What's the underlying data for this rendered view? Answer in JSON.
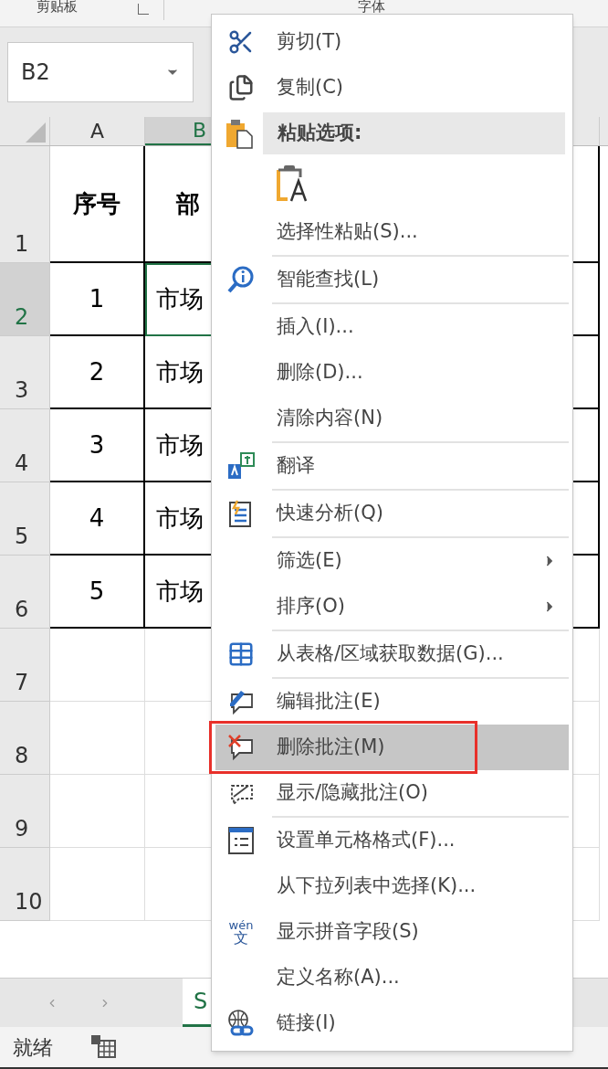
{
  "ribbon": {
    "groups": [
      {
        "label": "剪贴板"
      },
      {
        "label": "字体"
      }
    ]
  },
  "name_box": {
    "value": "B2"
  },
  "columns": [
    {
      "label": "A",
      "selected": false
    },
    {
      "label": "B",
      "selected": true
    }
  ],
  "rows": [
    {
      "number": "1",
      "selected": false,
      "cells": [
        "序号",
        "部"
      ]
    },
    {
      "number": "2",
      "selected": true,
      "cells": [
        "1",
        "市场"
      ]
    },
    {
      "number": "3",
      "selected": false,
      "cells": [
        "2",
        "市场"
      ]
    },
    {
      "number": "4",
      "selected": false,
      "cells": [
        "3",
        "市场"
      ]
    },
    {
      "number": "5",
      "selected": false,
      "cells": [
        "4",
        "市场"
      ]
    },
    {
      "number": "6",
      "selected": false,
      "cells": [
        "5",
        "市场"
      ]
    },
    {
      "number": "7",
      "selected": false
    },
    {
      "number": "8",
      "selected": false
    },
    {
      "number": "9",
      "selected": false
    },
    {
      "number": "10",
      "selected": false
    }
  ],
  "sheet_tabs": [
    {
      "label": "S",
      "selected": true
    }
  ],
  "status_bar": {
    "text": "就绪"
  },
  "context_menu": {
    "items": [
      {
        "kind": "command",
        "label": "剪切(T)",
        "selected": false,
        "outlined": false
      },
      {
        "kind": "command",
        "label": "复制(C)",
        "selected": false,
        "outlined": false
      },
      {
        "kind": "header",
        "label": "粘贴选项:",
        "selected": true,
        "outlined": false
      },
      {
        "kind": "paste-option",
        "selected": false,
        "outlined": false
      },
      {
        "kind": "command",
        "label": "选择性粘贴(S)...",
        "selected": false,
        "outlined": false
      },
      {
        "kind": "separator"
      },
      {
        "kind": "command",
        "label": "智能查找(L)",
        "selected": false,
        "outlined": false
      },
      {
        "kind": "separator"
      },
      {
        "kind": "command",
        "label": "插入(I)...",
        "selected": false,
        "outlined": false
      },
      {
        "kind": "command",
        "label": "删除(D)...",
        "selected": false,
        "outlined": false
      },
      {
        "kind": "command",
        "label": "清除内容(N)",
        "selected": false,
        "outlined": false
      },
      {
        "kind": "separator"
      },
      {
        "kind": "command",
        "label": "翻译",
        "selected": false,
        "outlined": false
      },
      {
        "kind": "separator"
      },
      {
        "kind": "command",
        "label": "快速分析(Q)",
        "selected": false,
        "outlined": false
      },
      {
        "kind": "separator"
      },
      {
        "kind": "submenu",
        "label": "筛选(E)",
        "selected": false,
        "outlined": false
      },
      {
        "kind": "submenu",
        "label": "排序(O)",
        "selected": false,
        "outlined": false
      },
      {
        "kind": "separator"
      },
      {
        "kind": "command",
        "label": "从表格/区域获取数据(G)...",
        "selected": false,
        "outlined": false
      },
      {
        "kind": "separator"
      },
      {
        "kind": "command",
        "label": "编辑批注(E)",
        "selected": false,
        "outlined": false
      },
      {
        "kind": "command",
        "label": "删除批注(M)",
        "selected": true,
        "outlined": true
      },
      {
        "kind": "command",
        "label": "显示/隐藏批注(O)",
        "selected": false,
        "outlined": false
      },
      {
        "kind": "separator"
      },
      {
        "kind": "command",
        "label": "设置单元格格式(F)...",
        "selected": false,
        "outlined": false
      },
      {
        "kind": "command",
        "label": "从下拉列表中选择(K)...",
        "selected": false,
        "outlined": false
      },
      {
        "kind": "command",
        "label": "显示拼音字段(S)",
        "icon_text": [
          "wén",
          "文"
        ],
        "selected": false,
        "outlined": false
      },
      {
        "kind": "command",
        "label": "定义名称(A)...",
        "selected": false,
        "outlined": false
      },
      {
        "kind": "command",
        "label": "链接(I)",
        "selected": false,
        "outlined": false
      }
    ]
  }
}
